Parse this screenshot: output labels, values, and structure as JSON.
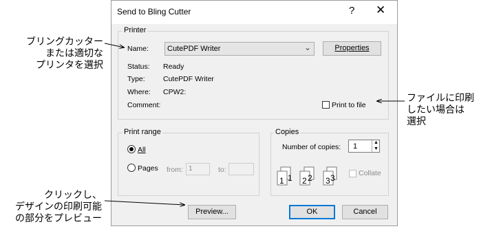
{
  "dialog": {
    "title": "Send to Bling Cutter",
    "help": "?",
    "close": "✕"
  },
  "printer": {
    "group_label": "Printer",
    "name_label": "Name:",
    "name_value": "CutePDF Writer",
    "properties_button": "Properties",
    "status_label": "Status:",
    "status_value": "Ready",
    "type_label": "Type:",
    "type_value": "CutePDF Writer",
    "where_label": "Where:",
    "where_value": "CPW2:",
    "comment_label": "Comment:",
    "print_to_file": "Print to file"
  },
  "print_range": {
    "group_label": "Print range",
    "all": "All",
    "pages": "Pages",
    "from_label": "from:",
    "from_value": "1",
    "to_label": "to:",
    "to_value": ""
  },
  "copies": {
    "group_label": "Copies",
    "number_label": "Number of copies:",
    "number_value": "1",
    "collate": "Collate"
  },
  "buttons": {
    "preview": "Preview...",
    "ok": "OK",
    "cancel": "Cancel"
  },
  "annotations": {
    "left_top": [
      "ブリングカッター",
      "または適切な",
      "プリンタを選択"
    ],
    "right": [
      "ファイルに印刷",
      "したい場合は",
      "選択"
    ],
    "left_bottom": [
      "クリックし、",
      "デザインの印刷可能",
      "の部分をプレビュー"
    ]
  }
}
